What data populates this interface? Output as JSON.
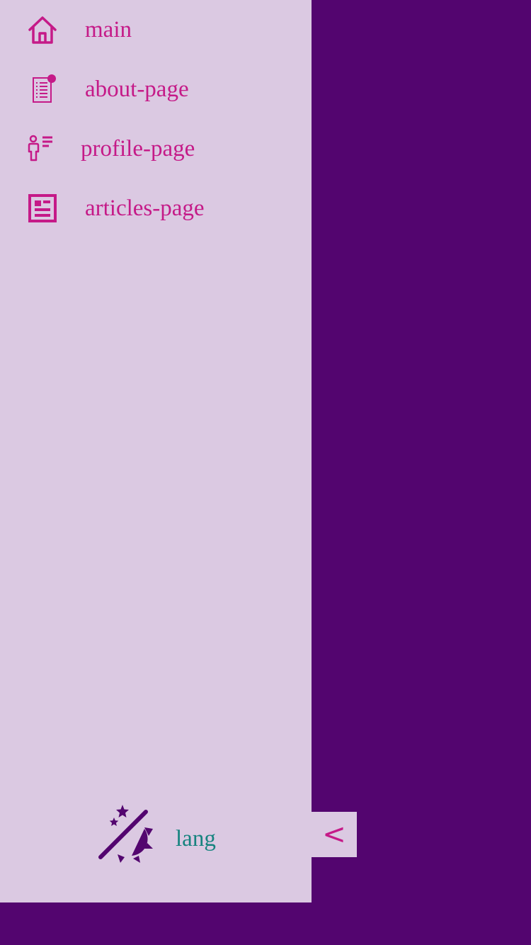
{
  "sidebar": {
    "items": [
      {
        "label": "main",
        "icon": "home-icon"
      },
      {
        "label": "about-page",
        "icon": "document-icon"
      },
      {
        "label": "profile-page",
        "icon": "profile-icon"
      },
      {
        "label": "articles-page",
        "icon": "articles-icon"
      }
    ],
    "footer": {
      "theme_icon": "theme-switch-icon",
      "lang_label": "lang"
    },
    "collapse_label": "<"
  },
  "colors": {
    "sidebar_bg": "#dbc9e2",
    "page_bg": "#53056f",
    "accent": "#c51a88",
    "theme_icon": "#53056f",
    "lang_text": "#16837f"
  }
}
